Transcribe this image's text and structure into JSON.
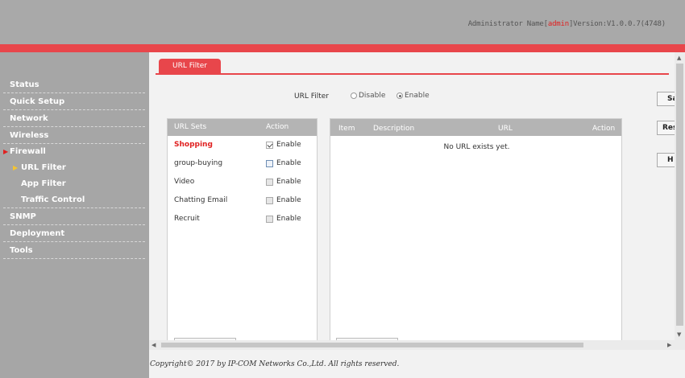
{
  "header": {
    "info_prefix": "Administrator Name[",
    "admin_name": "admin",
    "info_suffix": "]Version:V1.0.0.7(4748)"
  },
  "sidebar": {
    "items": [
      {
        "label": "Status"
      },
      {
        "label": "Quick Setup"
      },
      {
        "label": "Network"
      },
      {
        "label": "Wireless"
      },
      {
        "label": "Firewall"
      },
      {
        "label": "URL Filter"
      },
      {
        "label": "App Filter"
      },
      {
        "label": "Traffic Control"
      },
      {
        "label": "SNMP"
      },
      {
        "label": "Deployment"
      },
      {
        "label": "Tools"
      }
    ],
    "arrow_glyph": "▶"
  },
  "tab": {
    "label": "URL Filter"
  },
  "filter": {
    "label": "URL Filter",
    "options": [
      "Disable",
      "Enable"
    ],
    "selected": "Enable"
  },
  "side_buttons": [
    "Sa",
    "Res",
    "H"
  ],
  "url_sets": {
    "headers": {
      "sets": "URL Sets",
      "action": "Action"
    },
    "rows": [
      {
        "name": "Shopping",
        "action": "Enable",
        "checked": true,
        "active": true
      },
      {
        "name": "group-buying",
        "action": "Enable",
        "checked": false,
        "active": false
      },
      {
        "name": "Video",
        "action": "Enable",
        "checked": false,
        "active": false
      },
      {
        "name": "Chatting Email",
        "action": "Enable",
        "checked": false,
        "active": false
      },
      {
        "name": "Recruit",
        "action": "Enable",
        "checked": false,
        "active": false
      }
    ]
  },
  "url_table": {
    "headers": {
      "item": "Item",
      "description": "Description",
      "url": "URL",
      "action": "Action"
    },
    "empty_message": "No URL exists yet."
  },
  "footer": {
    "text": "Copyright© 2017 by IP-COM Networks Co.,Ltd. All rights reserved."
  },
  "colors": {
    "accent": "#e8464b",
    "sidebar": "#a6a6a6",
    "header": "#a9a9a9"
  }
}
